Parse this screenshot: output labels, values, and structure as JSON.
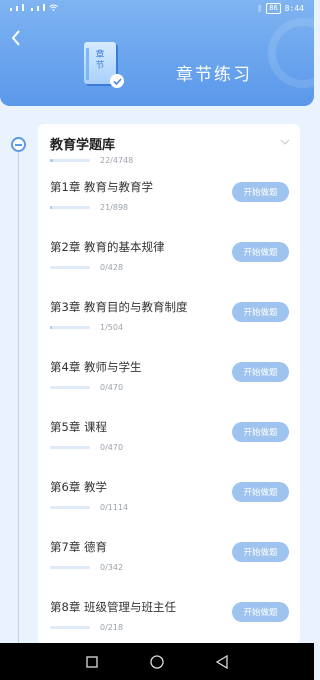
{
  "status": {
    "time": "8:44",
    "battery": "86"
  },
  "header": {
    "title": "章节练习",
    "book_glyphs": "章节"
  },
  "bank": {
    "title": "教育学题库",
    "count": "22/4748",
    "progress": 0.005
  },
  "chapters": [
    {
      "name": "第1章 教育与教育学",
      "count": "21/898",
      "progress": 0.023,
      "button": "开始做题"
    },
    {
      "name": "第2章 教育的基本规律",
      "count": "0/428",
      "progress": 0,
      "button": "开始做题"
    },
    {
      "name": "第3章 教育目的与教育制度",
      "count": "1/504",
      "progress": 0.002,
      "button": "开始做题"
    },
    {
      "name": "第4章 教师与学生",
      "count": "0/470",
      "progress": 0,
      "button": "开始做题"
    },
    {
      "name": "第5章 课程",
      "count": "0/470",
      "progress": 0,
      "button": "开始做题"
    },
    {
      "name": "第6章 教学",
      "count": "0/1114",
      "progress": 0,
      "button": "开始做题"
    },
    {
      "name": "第7章 德育",
      "count": "0/342",
      "progress": 0,
      "button": "开始做题"
    },
    {
      "name": "第8章 班级管理与班主任",
      "count": "0/218",
      "progress": 0,
      "button": "开始做题"
    }
  ],
  "colors": {
    "accent": "#5a98ea",
    "button": "#9ec3ef",
    "bar_fill": "#a7c6ea",
    "bar_track": "#dfeaf8"
  },
  "icons": [
    "back-arrow-icon",
    "book-icon",
    "check-icon",
    "chevron-down-icon",
    "nav-recent-icon",
    "nav-home-icon",
    "nav-back-icon"
  ]
}
